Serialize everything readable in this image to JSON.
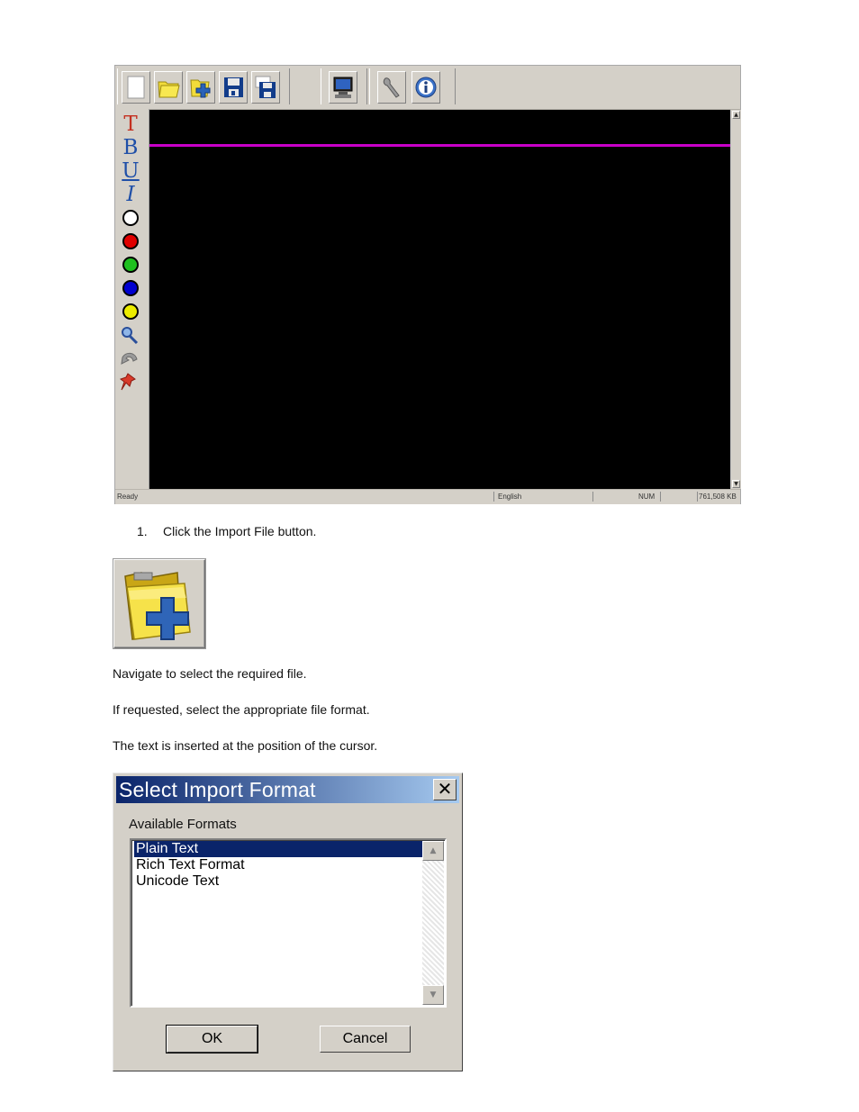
{
  "app": {
    "toolbar_icons": [
      "new-document-icon",
      "open-folder-icon",
      "import-file-icon",
      "save-icon",
      "save-as-icon",
      "monitor-icon",
      "wrench-icon",
      "info-icon"
    ],
    "left_tools": [
      {
        "icon": "text-style-icon",
        "glyph": "T"
      },
      {
        "icon": "bold-icon",
        "glyph": "B"
      },
      {
        "icon": "underline-icon",
        "glyph": "U"
      },
      {
        "icon": "italic-icon",
        "glyph": "I"
      },
      {
        "icon": "white-color-icon",
        "color": "#ffffff"
      },
      {
        "icon": "red-color-icon",
        "color": "#e00000"
      },
      {
        "icon": "green-color-icon",
        "color": "#1fc01f"
      },
      {
        "icon": "blue-color-icon",
        "color": "#0000d0"
      },
      {
        "icon": "yellow-color-icon",
        "color": "#ecec00"
      },
      {
        "icon": "find-replace-icon"
      },
      {
        "icon": "undo-icon"
      },
      {
        "icon": "pin-icon"
      }
    ],
    "status": {
      "state": "Ready",
      "language": "English",
      "num": "NUM",
      "memory": "761,508 KB"
    },
    "colors": {
      "canvas": "#000000",
      "cursor_line": "#c800c8"
    }
  },
  "instructions": {
    "step_number": "1.",
    "step_text": "Click the Import File button.",
    "para1": "Navigate to select the required file.",
    "para2": "If requested, select the appropriate file format.",
    "para3": "The text is inserted at the position of the cursor."
  },
  "dialog": {
    "title": "Select Import Format",
    "close_glyph": "✕",
    "label": "Available Formats",
    "formats": [
      "Plain Text",
      "Rich Text Format",
      "Unicode Text"
    ],
    "selected_index": 0,
    "ok_label": "OK",
    "cancel_label": "Cancel"
  }
}
